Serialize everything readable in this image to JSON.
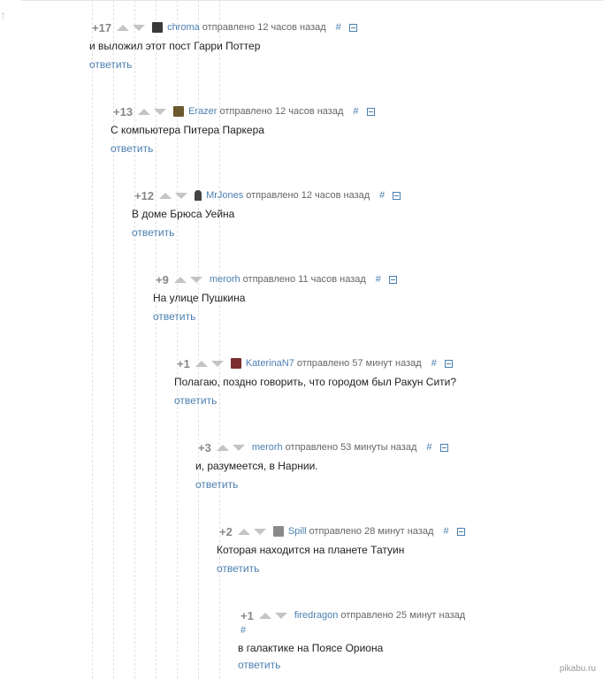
{
  "comments": [
    {
      "rating": "+17",
      "user": "chroma",
      "sent": "отправлено 12 часов назад",
      "hash": "#",
      "text": "и выложил этот пост Гарри Поттер",
      "reply": "ответить",
      "avatar_color": "#3a3a3a"
    },
    {
      "rating": "+13",
      "user": "Erazer",
      "sent": "отправлено 12 часов назад",
      "hash": "#",
      "text": "С компьютера Питера Паркера",
      "reply": "ответить",
      "avatar_color": "#6b5a2e"
    },
    {
      "rating": "+12",
      "user": "MrJones",
      "sent": "отправлено 12 часов назад",
      "hash": "#",
      "text": "В доме Брюса Уейна",
      "reply": "ответить",
      "avatar_color": "#444444"
    },
    {
      "rating": "+9",
      "user": "merorh",
      "sent": "отправлено 11 часов назад",
      "hash": "#",
      "text": "На улице Пушкина",
      "reply": "ответить",
      "avatar_color": ""
    },
    {
      "rating": "+1",
      "user": "KaterinaN7",
      "sent": "отправлено 57 минут назад",
      "hash": "#",
      "text": "Полагаю, поздно говорить, что городом был Ракун Сити?",
      "reply": "ответить",
      "avatar_color": "#7a2e2e"
    },
    {
      "rating": "+3",
      "user": "merorh",
      "sent": "отправлено 53 минуты назад",
      "hash": "#",
      "text": "и, разумеется, в Нарнии.",
      "reply": "ответить",
      "avatar_color": ""
    },
    {
      "rating": "+2",
      "user": "Spill",
      "sent": "отправлено 28 минут назад",
      "hash": "#",
      "text": "Которая находится на планете Татуин",
      "reply": "ответить",
      "avatar_color": "#8a8a8a"
    },
    {
      "rating": "+1",
      "user": "firedragon",
      "sent": "отправлено 25 минут назад",
      "hash": "#",
      "text": "в галактике на Поясе Ориона",
      "reply": "ответить",
      "avatar_color": ""
    }
  ],
  "watermark": "pikabu.ru",
  "colors": {
    "link": "#4a7fb0",
    "vote": "#c4c4c4",
    "guide": "#e3e3e3"
  },
  "icons": {
    "up": "arrow-up-icon",
    "down": "arrow-down-icon",
    "collapse": "collapse-icon",
    "back": "up-arrow-icon"
  }
}
